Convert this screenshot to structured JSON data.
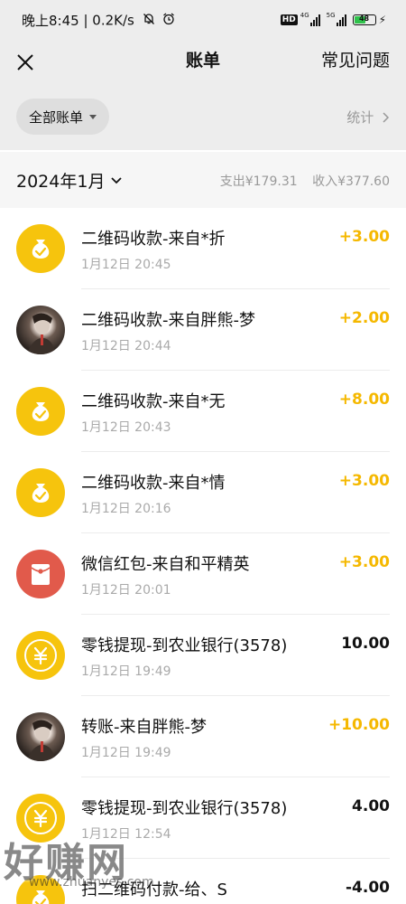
{
  "status_bar": {
    "time": "晚上8:45",
    "speed": "0.2K/s",
    "hd": "HD",
    "net_1": "4G",
    "net_2": "5G",
    "battery": "48"
  },
  "nav": {
    "title": "账单",
    "faq": "常见问题"
  },
  "filter": {
    "all_bills": "全部账单",
    "stats": "统计"
  },
  "month": {
    "label": "2024年1月",
    "expense": "支出¥179.31",
    "income": "收入¥377.60"
  },
  "transactions": [
    {
      "icon": "money-bag-icon",
      "title": "二维码收款-来自*折",
      "time": "1月12日 20:45",
      "amount": "+3.00",
      "type": "income"
    },
    {
      "icon": "user-photo-avatar",
      "title": "二维码收款-来自胖熊-梦",
      "time": "1月12日 20:44",
      "amount": "+2.00",
      "type": "income"
    },
    {
      "icon": "money-bag-icon",
      "title": "二维码收款-来自*无",
      "time": "1月12日 20:43",
      "amount": "+8.00",
      "type": "income"
    },
    {
      "icon": "money-bag-icon",
      "title": "二维码收款-来自*情",
      "time": "1月12日 20:16",
      "amount": "+3.00",
      "type": "income"
    },
    {
      "icon": "red-packet-icon",
      "title": "微信红包-来自和平精英",
      "time": "1月12日 20:01",
      "amount": "+3.00",
      "type": "income"
    },
    {
      "icon": "yuan-coin-icon",
      "title": "零钱提现-到农业银行(3578)",
      "time": "1月12日 19:49",
      "amount": "10.00",
      "type": "expense"
    },
    {
      "icon": "user-photo-avatar",
      "title": "转账-来自胖熊-梦",
      "time": "1月12日 19:49",
      "amount": "+10.00",
      "type": "income"
    },
    {
      "icon": "yuan-coin-icon",
      "title": "零钱提现-到农业银行(3578)",
      "time": "1月12日 12:54",
      "amount": "4.00",
      "type": "expense"
    },
    {
      "icon": "money-bag-icon",
      "title": "扫二维码付款-给、S",
      "time": "",
      "amount": "-4.00",
      "type": "expense"
    }
  ],
  "watermark": {
    "main": "好赚网",
    "url": "www.zhuanyes.com"
  },
  "colors": {
    "income": "#f5b800",
    "icon_yellow": "#f6c40d",
    "icon_red": "#e15a4b",
    "header_bg": "#ededed"
  }
}
